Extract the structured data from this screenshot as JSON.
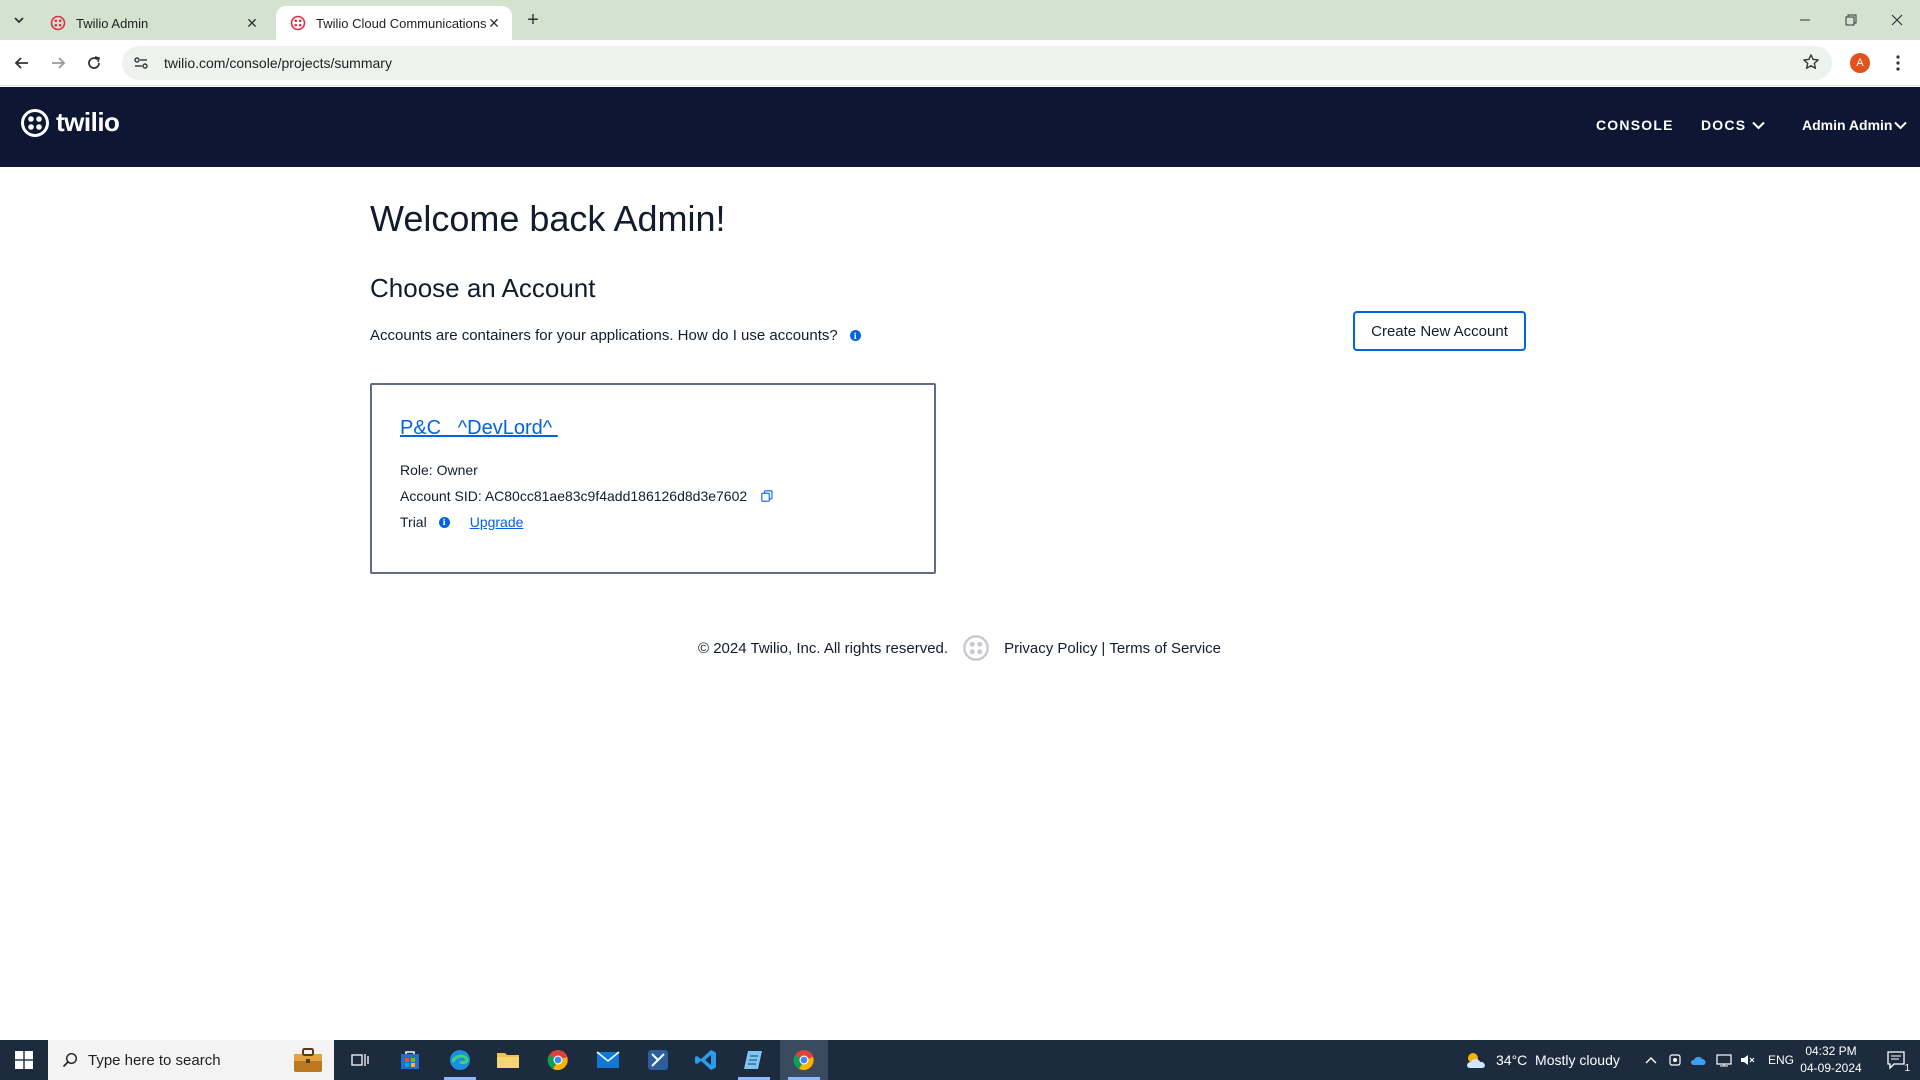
{
  "browser": {
    "tabs": [
      {
        "title": "Twilio Admin",
        "active": false
      },
      {
        "title": "Twilio Cloud Communications |",
        "active": true
      }
    ],
    "url": "twilio.com/console/projects/summary",
    "profile_initial": "A"
  },
  "header": {
    "logo_text": "twilio",
    "nav": {
      "console": "CONSOLE",
      "docs": "DOCS",
      "user": "Admin Admin"
    }
  },
  "main": {
    "welcome": "Welcome back Admin!",
    "choose_heading": "Choose an Account",
    "description": "Accounts are containers for your applications. How do I use accounts?",
    "create_button": "Create New Account",
    "account": {
      "name": "P&C   ^DevLord^ ",
      "role_label": "Role: Owner",
      "sid_label": "Account SID: AC80cc81ae83c9f4add186126d8d3e7602",
      "type": "Trial",
      "upgrade_label": "Upgrade"
    }
  },
  "footer": {
    "copyright": "© 2024 Twilio, Inc. All rights reserved.",
    "privacy": "Privacy Policy",
    "separator": "|",
    "terms": "Terms of Service"
  },
  "taskbar": {
    "search_placeholder": "Type here to search",
    "weather": "34°C  Mostly cloudy",
    "language": "ENG",
    "time": "04:32 PM",
    "date": "04-09-2024",
    "notification_count": "1"
  },
  "colors": {
    "header_bg": "#0d1733",
    "link": "#0263e0",
    "tabbar_bg": "#d3e3d0",
    "taskbar_bg": "#1c2b3e"
  }
}
